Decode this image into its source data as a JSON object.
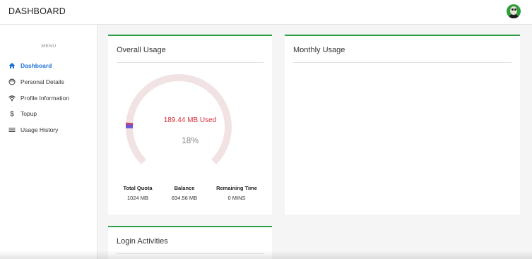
{
  "header": {
    "title": "DASHBOARD",
    "avatar_icon": "user-avatar-icon"
  },
  "sidebar": {
    "menu_title": "MENU",
    "items": [
      {
        "label": "Dashboard",
        "icon": "home-icon",
        "active": true
      },
      {
        "label": "Personal Details",
        "icon": "face-icon",
        "active": false
      },
      {
        "label": "Profile Information",
        "icon": "wifi-icon",
        "active": false
      },
      {
        "label": "Topup",
        "icon": "dollar-icon",
        "active": false
      },
      {
        "label": "Usage History",
        "icon": "menu-lines-icon",
        "active": false
      }
    ]
  },
  "overall_usage": {
    "title": "Overall Usage",
    "used_text": "189.44 MB Used",
    "percent_text": "18%",
    "percent_value": 18,
    "stats": [
      {
        "label": "Total Quota",
        "value": "1024 MB"
      },
      {
        "label": "Balance",
        "value": "834.56 MB"
      },
      {
        "label": "Remaining Time",
        "value": "0 MINS"
      }
    ]
  },
  "monthly_usage": {
    "title": "Monthly Usage"
  },
  "login_activities": {
    "title": "Login Activities"
  },
  "colors": {
    "accent_green": "#2e9e47",
    "active_blue": "#1e73d8",
    "used_red": "#d4303a",
    "gauge_track": "#f1e3e3",
    "gauge_start": "#6a55d8",
    "gauge_end": "#e0404a"
  }
}
